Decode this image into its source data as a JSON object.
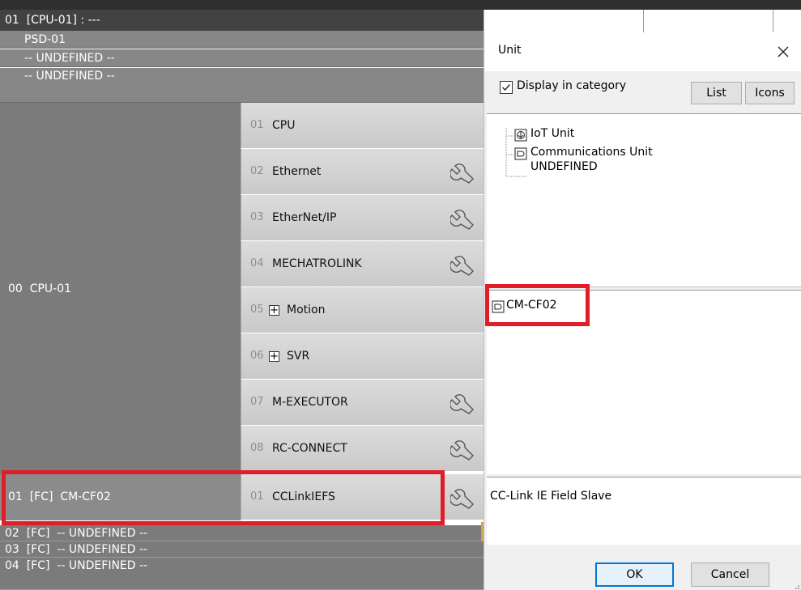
{
  "header": {
    "title": "01  [CPU-01] : ---"
  },
  "slots": [
    {
      "label": "PSD-01"
    },
    {
      "label": "-- UNDEFINED --"
    },
    {
      "label": "-- UNDEFINED --"
    }
  ],
  "cpu": {
    "label": "00  CPU-01"
  },
  "modules": [
    {
      "num": "01",
      "name": "CPU",
      "expand": false,
      "wrench": false
    },
    {
      "num": "02",
      "name": "Ethernet",
      "expand": false,
      "wrench": true
    },
    {
      "num": "03",
      "name": "EtherNet/IP",
      "expand": false,
      "wrench": true
    },
    {
      "num": "04",
      "name": "MECHATROLINK",
      "expand": false,
      "wrench": true
    },
    {
      "num": "05",
      "name": "Motion",
      "expand": true,
      "expand_glyph": "+",
      "wrench": false
    },
    {
      "num": "06",
      "name": "SVR",
      "expand": true,
      "expand_glyph": "+",
      "wrench": false
    },
    {
      "num": "07",
      "name": "M-EXECUTOR",
      "expand": false,
      "wrench": true
    },
    {
      "num": "08",
      "name": "RC-CONNECT",
      "expand": false,
      "wrench": true
    }
  ],
  "fc_rows": {
    "selected": {
      "label": "01  [FC]  CM-CF02",
      "num": "01",
      "name": "CCLinkIEFS"
    },
    "rest": [
      {
        "label": "02  [FC]  -- UNDEFINED --"
      },
      {
        "label": "03  [FC]  -- UNDEFINED --"
      },
      {
        "label": "04  [FC]  -- UNDEFINED --"
      }
    ]
  },
  "dialog": {
    "title": "Unit",
    "display_in_category": {
      "label": "Display in category",
      "checked": true
    },
    "buttons": {
      "list": "List",
      "icons": "Icons"
    },
    "tree": {
      "items": [
        {
          "label": "IoT Unit",
          "icon": "iot-unit-icon"
        },
        {
          "label": "Communications Unit",
          "icon": "communications-unit-icon"
        },
        {
          "label": "UNDEFINED",
          "icon": ""
        }
      ]
    },
    "unit_list": {
      "items": [
        {
          "label": "CM-CF02",
          "icon": "communications-unit-icon"
        }
      ]
    },
    "description": "CC-Link IE Field Slave",
    "ok_label": "OK",
    "cancel_label": "Cancel"
  },
  "colors": {
    "highlight": "#e11d2a",
    "ok_border": "#0078d7",
    "header_bg": "#424242",
    "module_bg": "#d4d4d4"
  }
}
